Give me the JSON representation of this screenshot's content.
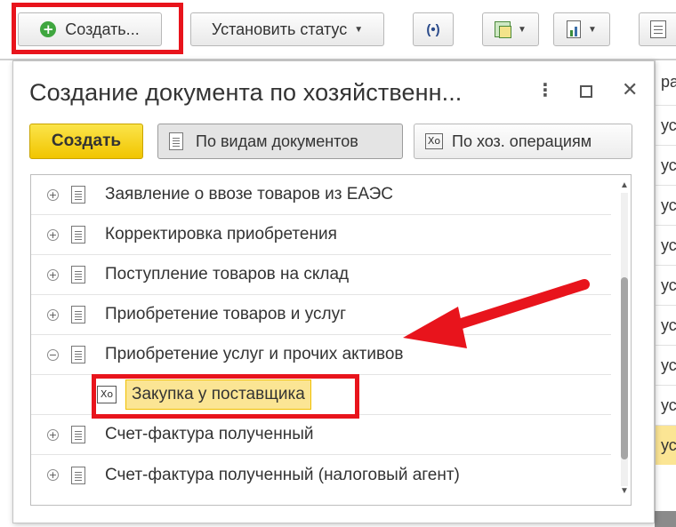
{
  "toolbar": {
    "create_label": "Создать...",
    "set_status_label": "Установить статус",
    "icon_names": [
      "plus-circle-icon",
      "broadcast-icon",
      "copy-create-icon",
      "report-icon",
      "print-icon"
    ]
  },
  "background_list": {
    "header_cell": "ра",
    "cells": [
      "ус",
      "ус",
      "ус",
      "ус",
      "ус",
      "ус",
      "ус",
      "ус",
      "ус"
    ]
  },
  "dialog": {
    "title": "Создание документа по хозяйственн...",
    "create_label": "Создать",
    "mode_documents_label": "По видам документов",
    "mode_operations_label": "По хоз. операциям",
    "operation_icon_glyph": "Xo",
    "tree": [
      {
        "label": "Заявление о ввозе товаров из ЕАЭС",
        "state": "collapsed"
      },
      {
        "label": "Корректировка приобретения",
        "state": "collapsed"
      },
      {
        "label": "Поступление товаров на склад",
        "state": "collapsed"
      },
      {
        "label": "Приобретение товаров и услуг",
        "state": "collapsed"
      },
      {
        "label": "Приобретение услуг и прочих активов",
        "state": "expanded"
      },
      {
        "label": "Закупка у поставщика",
        "state": "selected-child"
      },
      {
        "label": "Счет-фактура полученный",
        "state": "collapsed"
      },
      {
        "label": "Счет-фактура полученный (налоговый агент)",
        "state": "collapsed"
      }
    ]
  },
  "colors": {
    "highlight": "#e8141c",
    "create_button": "#f1c500",
    "selection": "#fbe594",
    "arrow": "#e8141c"
  }
}
